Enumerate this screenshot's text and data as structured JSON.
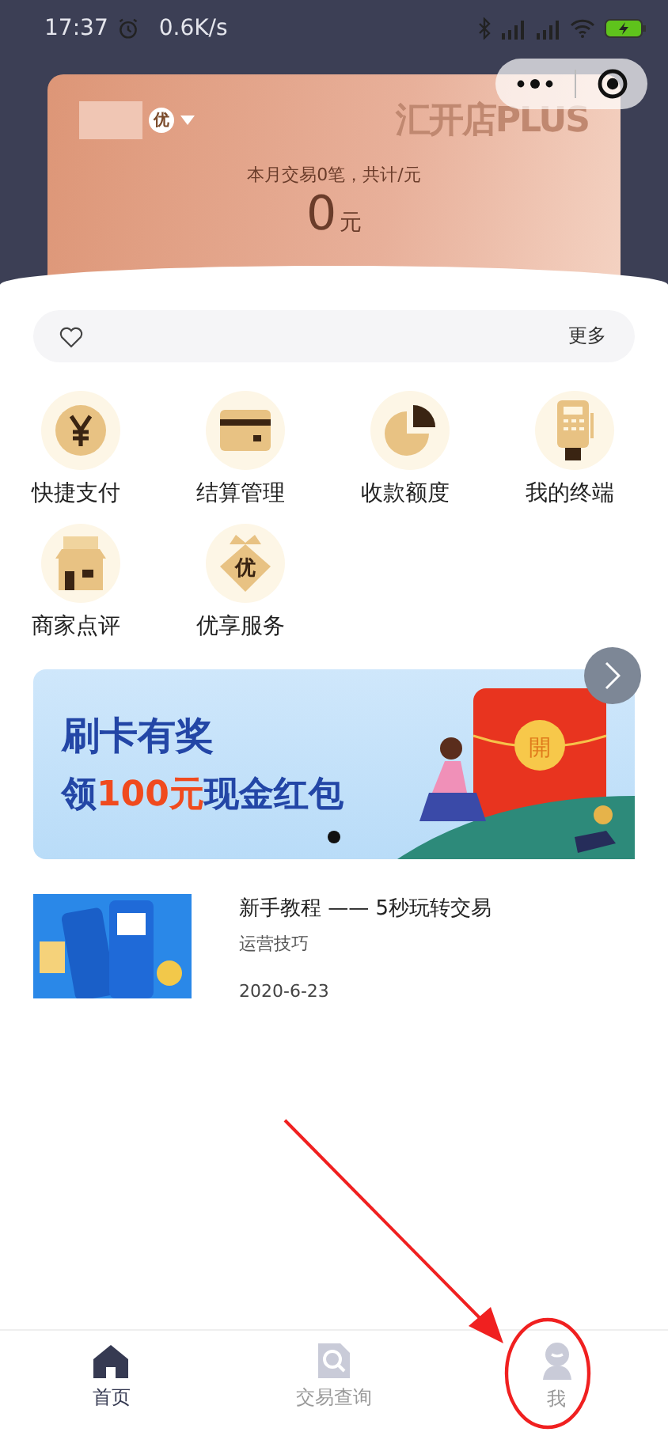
{
  "status_bar": {
    "time": "17:37",
    "speed": "0.6K/s"
  },
  "card": {
    "badge": "优",
    "logo": "汇开店PLUS",
    "summary": "本月交易0笔，共计/元",
    "amount": "0",
    "unit": "元"
  },
  "notice": {
    "more": "更多"
  },
  "services": [
    {
      "label": "快捷支付",
      "kind": "yen"
    },
    {
      "label": "结算管理",
      "kind": "card"
    },
    {
      "label": "收款额度",
      "kind": "pie"
    },
    {
      "label": "我的终端",
      "kind": "terminal"
    },
    {
      "label": "商家点评",
      "kind": "shop"
    },
    {
      "label": "优享服务",
      "kind": "vip",
      "glyph": "优"
    }
  ],
  "banner": {
    "title": "刷卡有奖",
    "subtitle": [
      {
        "text": "领",
        "highlight": false
      },
      {
        "text": "100元",
        "highlight": true
      },
      {
        "text": "现金红包",
        "highlight": false
      }
    ],
    "seal": "開",
    "pages": [
      {
        "selected": true
      }
    ]
  },
  "article": {
    "title": "新手教程 —— 5秒玩转交易",
    "category": "运营技巧",
    "date": "2020-6-23"
  },
  "tabs": [
    {
      "label": "首页",
      "kind": "home",
      "selected": true
    },
    {
      "label": "交易查询",
      "kind": "search",
      "selected": false
    },
    {
      "label": "我",
      "kind": "user",
      "selected": false
    }
  ]
}
